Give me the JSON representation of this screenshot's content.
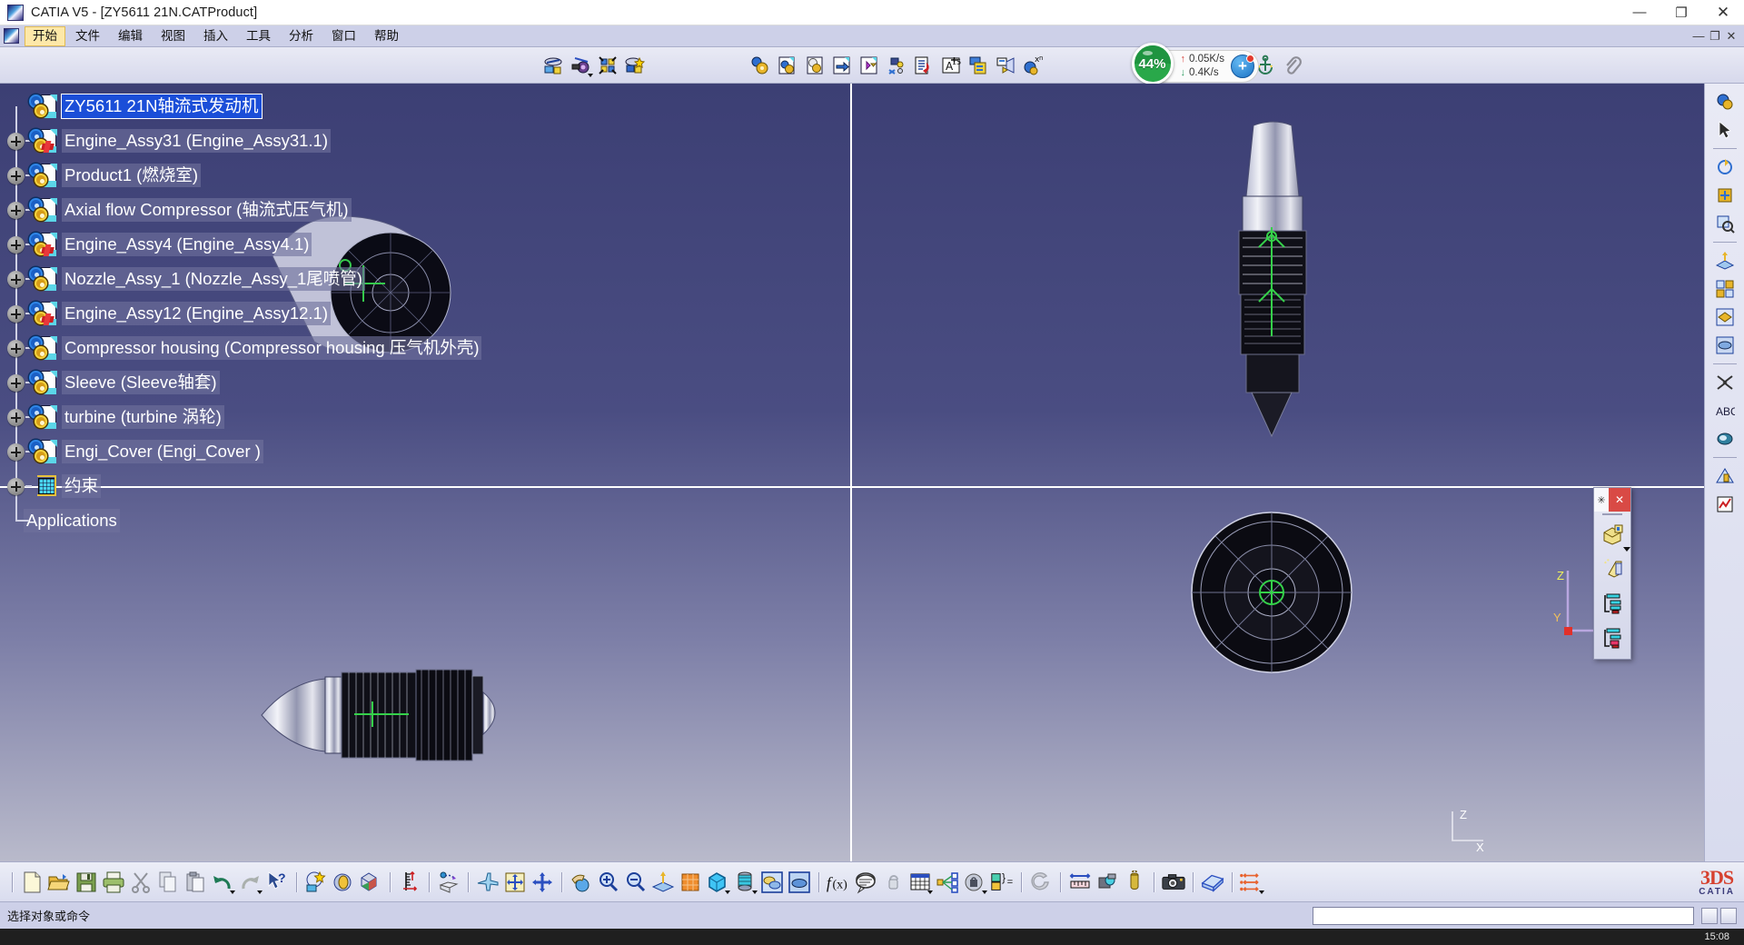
{
  "window": {
    "title": "CATIA V5 - [ZY5611 21N.CATProduct]",
    "app_icon": "catia-logo-icon",
    "minimize": "—",
    "maximize": "❐",
    "close": "✕"
  },
  "menubar": {
    "icon": "catia-document-icon",
    "items": [
      {
        "label": "开始",
        "name": "menu-start",
        "active": true
      },
      {
        "label": "文件",
        "name": "menu-file",
        "active": false
      },
      {
        "label": "编辑",
        "name": "menu-edit",
        "active": false
      },
      {
        "label": "视图",
        "name": "menu-view",
        "active": false
      },
      {
        "label": "插入",
        "name": "menu-insert",
        "active": false
      },
      {
        "label": "工具",
        "name": "menu-tools",
        "active": false
      },
      {
        "label": "分析",
        "name": "menu-analyze",
        "active": false
      },
      {
        "label": "窗口",
        "name": "menu-window",
        "active": false
      },
      {
        "label": "帮助",
        "name": "menu-help",
        "active": false
      }
    ],
    "doc_controls": [
      "—",
      "❐",
      "✕"
    ]
  },
  "toolbar": {
    "groups": [
      {
        "name": "assembly-constraints-group",
        "icons": [
          "manipulate-icon",
          "snap-icon",
          "explode-icon",
          "clash-icon"
        ]
      },
      {
        "name": "product-structure-group",
        "icons": [
          "existing-component-icon",
          "component-with-positioning-icon",
          "new-part-icon",
          "replace-component-icon",
          "reuse-pattern-icon",
          "flexible-rigid-icon",
          "generate-numbering-icon",
          "selective-load-icon",
          "manage-representations-icon",
          "fast-multi-instantiation-icon",
          "define-multi-instantiation-icon"
        ]
      },
      {
        "name": "measure-annotation-group",
        "icons": [
          "apply-material-icon",
          "bounding-box-icon",
          "scene-icon",
          "measure-item-icon",
          "anchor-icon",
          "attach-icon"
        ]
      }
    ]
  },
  "network_widget": {
    "percent": "44%",
    "upload": "0.05K/s",
    "download": "0.4K/s",
    "upload_arrow": "↑",
    "download_arrow": "↓",
    "plus_label": "+",
    "gauge_color": "#29a84a"
  },
  "tree": {
    "root": {
      "label": "ZY5611 21N轴流式发动机",
      "name": "tree-root-product",
      "selected": true,
      "icon": "product-gear-icon"
    },
    "items": [
      {
        "label": "Engine_Assy31 (Engine_Assy31.1)",
        "name": "tree-item-engine-assy31",
        "icon": "product-cgr-icon",
        "badge": "red-marker-icon"
      },
      {
        "label": "Product1 (燃烧室)",
        "name": "tree-item-product1",
        "icon": "product-gear-icon",
        "badge": ""
      },
      {
        "label": "Axial flow Compressor (轴流式压气机)",
        "name": "tree-item-axial-flow-compressor",
        "icon": "product-gear-icon",
        "badge": ""
      },
      {
        "label": "Engine_Assy4 (Engine_Assy4.1)",
        "name": "tree-item-engine-assy4",
        "icon": "product-cgr-icon",
        "badge": "red-marker-icon"
      },
      {
        "label": "Nozzle_Assy_1 (Nozzle_Assy_1尾喷管)",
        "name": "tree-item-nozzle-assy-1",
        "icon": "product-gear-icon",
        "badge": ""
      },
      {
        "label": "Engine_Assy12 (Engine_Assy12.1)",
        "name": "tree-item-engine-assy12",
        "icon": "product-cgr-icon",
        "badge": "red-marker-icon"
      },
      {
        "label": "Compressor housing (Compressor housing 压气机外壳)",
        "name": "tree-item-compressor-housing",
        "icon": "product-gear-icon",
        "badge": ""
      },
      {
        "label": "Sleeve (Sleeve轴套)",
        "name": "tree-item-sleeve",
        "icon": "product-gear-icon",
        "badge": ""
      },
      {
        "label": "turbine (turbine 涡轮)",
        "name": "tree-item-turbine",
        "icon": "product-gear-icon",
        "badge": ""
      },
      {
        "label": "Engi_Cover (Engi_Cover )",
        "name": "tree-item-engi-cover",
        "icon": "product-gear-icon",
        "badge": ""
      },
      {
        "label": "约束",
        "name": "tree-item-constraints",
        "icon": "constraints-grid-icon",
        "badge": ""
      }
    ],
    "applications": {
      "label": "Applications",
      "name": "tree-item-applications"
    }
  },
  "viewport": {
    "axis_labels": {
      "x": "X",
      "y": "Y",
      "z": "Z"
    },
    "compass": {
      "x": "X",
      "y": "Y",
      "z": "Z"
    }
  },
  "palette": {
    "name": "floating-palette",
    "title_glyph": "✳",
    "close_label": "✕",
    "items": [
      "isolate-part-icon",
      "open-in-new-window-icon",
      "tree-expand-icon",
      "tree-collapse-icon"
    ]
  },
  "right_toolbar": {
    "icons": [
      "fit-all-in-icon",
      "select-arrow-icon",
      "rotate-icon",
      "pan-icon",
      "zoom-window-icon",
      "view-normal-icon",
      "multi-view-icon",
      "hide-show-icon",
      "swap-visible-icon",
      "cut-section-icon",
      "annotation-text-icon",
      "apply-material-icon",
      "measure-icon",
      "analyze-icon"
    ]
  },
  "bottom_toolbar": {
    "groups": [
      {
        "name": "standard-group",
        "icons": [
          "new-document-icon",
          "open-folder-icon",
          "save-icon",
          "print-icon",
          "cut-scissors-icon",
          "copy-icon",
          "paste-icon",
          "undo-icon",
          "redo-icon",
          "whats-this-help-icon"
        ]
      },
      {
        "name": "rendering-group",
        "icons": [
          "quick-render-icon",
          "shading-environment-icon",
          "material-cube-icon"
        ]
      },
      {
        "name": "measure-group",
        "icons": [
          "measure-between-icon"
        ]
      },
      {
        "name": "update-group",
        "icons": [
          "update-all-icon"
        ]
      },
      {
        "name": "view-mode-group",
        "icons": [
          "fly-mode-icon",
          "fit-all-in-icon",
          "pan-move-icon"
        ]
      },
      {
        "name": "navigate-group",
        "icons": [
          "rotate-hand-icon",
          "zoom-in-icon",
          "zoom-out-icon",
          "normal-view-icon",
          "isometric-view-icon",
          "shading-cube-icon",
          "shading-material-icon",
          "hide-show-icon",
          "swap-visible-space-icon"
        ]
      },
      {
        "name": "knowledge-group",
        "icons": [
          "formula-fx-icon",
          "comment-icon",
          "lock-parameter-icon",
          "design-table-icon",
          "relation-icon",
          "law-icon",
          "parameter-set-icon"
        ]
      },
      {
        "name": "refresh-group",
        "icons": [
          "update-refresh-icon"
        ]
      },
      {
        "name": "analysis-group",
        "icons": [
          "measure-distance-icon",
          "measure-item-icon",
          "measure-inertia-icon"
        ]
      },
      {
        "name": "capture-group",
        "icons": [
          "camera-capture-icon"
        ]
      },
      {
        "name": "album-group",
        "icons": [
          "album-icon"
        ]
      },
      {
        "name": "constraint-group",
        "icons": [
          "constraints-creation-icon"
        ]
      }
    ],
    "logo": {
      "mark": "3DS",
      "word": "CATIA"
    }
  },
  "statusbar": {
    "message": "选择对象或命令",
    "input_value": "",
    "indicators": [
      "status-box-1",
      "status-box-2"
    ]
  },
  "taskbar": {
    "clock": "15:08"
  }
}
